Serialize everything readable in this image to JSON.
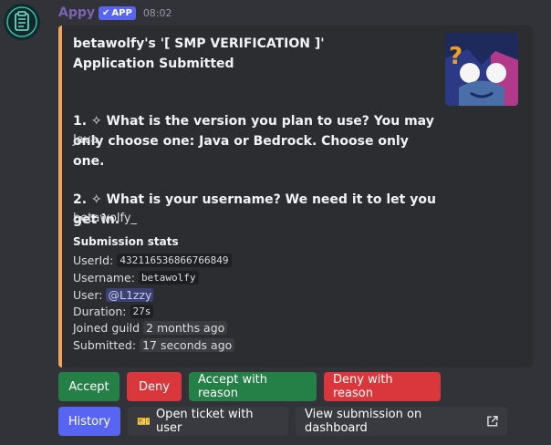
{
  "message": {
    "username": "Appy",
    "badge": "APP",
    "timestamp": "08:02"
  },
  "embed": {
    "title": "betawolfy's '[ SMP VERIFICATION ]' Application Submitted",
    "q1": "1. ✧ What is the version you plan to use? You may only choose one: Java or Bedrock. Choose only one.",
    "a1": "Java",
    "q2": "2. ✧ What is your username? We need it to let you get in.",
    "a2": "betawolfy_",
    "stats_title": "Submission stats",
    "stats": {
      "userid_label": "UserId:",
      "userid": "432116536866766849",
      "username_label": "Username:",
      "username": "betawolfy",
      "user_label": "User:",
      "user": "@L1zzy",
      "duration_label": "Duration:",
      "duration": "27s",
      "joined_label": "Joined guild",
      "joined": "2 months ago",
      "submitted_label": "Submitted:",
      "submitted": "17 seconds ago"
    },
    "accent_color": "#f0a35a"
  },
  "buttons": {
    "accept": "Accept",
    "deny": "Deny",
    "accept_reason": "Accept with reason",
    "deny_reason": "Deny with reason",
    "history": "History",
    "open_ticket": "Open ticket with user",
    "view_dashboard": "View submission on dashboard"
  },
  "icons": {
    "ticket": "🎫",
    "checkmark": "✔"
  }
}
